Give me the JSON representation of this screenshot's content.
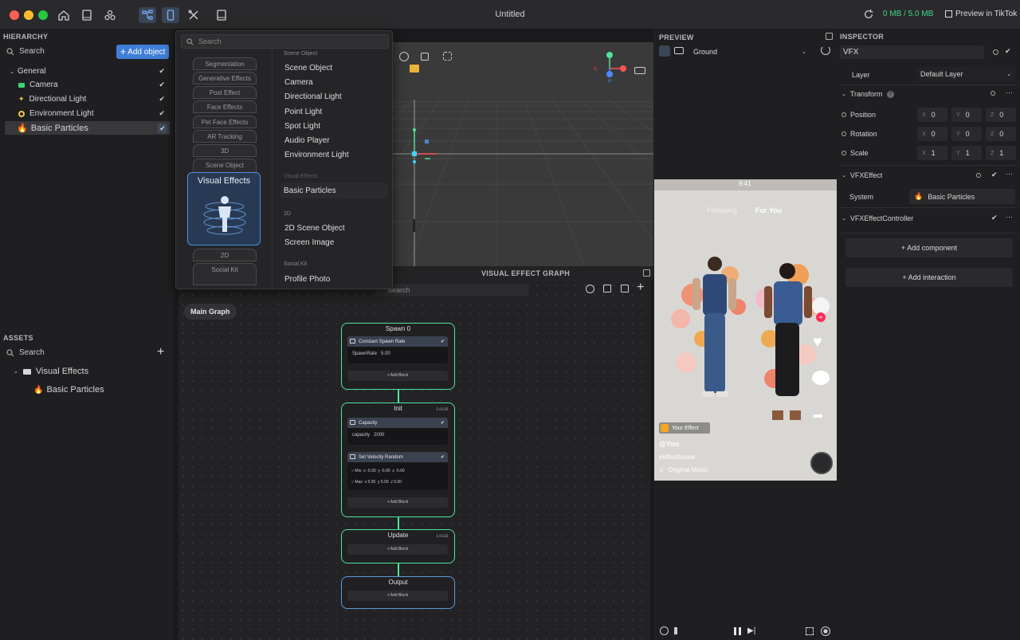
{
  "titlebar": {
    "title": "Untitled",
    "memory": "0 MB / 5.0 MB",
    "preview_tiktok": "Preview in TikTok"
  },
  "hierarchy": {
    "header": "HIERARCHY",
    "search_placeholder": "Search",
    "add_object": "Add object",
    "items": [
      {
        "label": "General"
      },
      {
        "label": "Camera"
      },
      {
        "label": "Directional Light"
      },
      {
        "label": "Environment Light"
      },
      {
        "label": "Basic Particles"
      }
    ]
  },
  "assets": {
    "header": "ASSETS",
    "search_placeholder": "Search",
    "folder": "Visual Effects",
    "item": "Basic Particles"
  },
  "dropdown": {
    "search_placeholder": "Search",
    "categories": [
      "Segmentation",
      "Generative Effects",
      "Post Effect",
      "Face Effects",
      "Pet Face Effects",
      "AR Tracking",
      "3D",
      "Scene Object"
    ],
    "selected_category": "Visual Effects",
    "categories_below": [
      "2D",
      "Social Kit"
    ],
    "sections": [
      {
        "title": "Scene Object",
        "items": [
          "Scene Object",
          "Camera",
          "Directional Light",
          "Point Light",
          "Spot Light",
          "Audio Player",
          "Environment Light"
        ]
      },
      {
        "title": "Visual Effects",
        "items": [
          "Basic Particles"
        ]
      },
      {
        "title": "2D",
        "items": [
          "2D Scene Object",
          "Screen Image"
        ]
      },
      {
        "title": "Social Kit",
        "items": [
          "Profile Photo"
        ]
      }
    ]
  },
  "graph": {
    "header": "VISUAL EFFECT GRAPH",
    "search_placeholder": "Search",
    "tab": "Main Graph",
    "spawn": {
      "title": "Spawn 0",
      "block": "Constant Spawn Rate",
      "param": "SpawnRate",
      "value": "5.00",
      "add": "+ Add Block"
    },
    "init": {
      "title": "Init",
      "local": "Local",
      "block1": "Capacity",
      "param1": "capacity",
      "value1": "2000",
      "block2": "Set Velocity Random",
      "min_label": "Min",
      "max_label": "Max",
      "min": [
        "-5.00",
        "-5.00",
        "-5.00"
      ],
      "max": [
        "5.00",
        "5.00",
        "5.00"
      ],
      "add": "+ Add Block"
    },
    "update": {
      "title": "Update",
      "local": "Local",
      "add": "+ Add Block"
    },
    "output": {
      "title": "Output",
      "add": "+ Add Block"
    }
  },
  "preview": {
    "header": "PREVIEW",
    "background": "Ground",
    "phone": {
      "time": "9:41",
      "following": "Following",
      "for_you": "For You",
      "your_effect": "Your Effect",
      "handle": "@You",
      "hashtag": "#effecthouse",
      "music": "Original Music"
    }
  },
  "inspector": {
    "header": "INSPECTOR",
    "name": "VFX",
    "layer_label": "Layer",
    "layer_value": "Default Layer",
    "transform": "Transform",
    "position": {
      "label": "Position",
      "x": "0",
      "y": "0",
      "z": "0"
    },
    "rotation": {
      "label": "Rotation",
      "x": "0",
      "y": "0",
      "z": "0"
    },
    "scale": {
      "label": "Scale",
      "x": "1",
      "y": "1",
      "z": "1"
    },
    "vfx_effect": "VFXEffect",
    "system_label": "System",
    "system_value": "Basic Particles",
    "vfx_controller": "VFXEffectController",
    "add_component": "+ Add component",
    "add_interaction": "+ Add interaction"
  },
  "colors": {
    "accent": "#3f7fd8",
    "node_green": "#52e39a",
    "memory_green": "#43d38a"
  }
}
